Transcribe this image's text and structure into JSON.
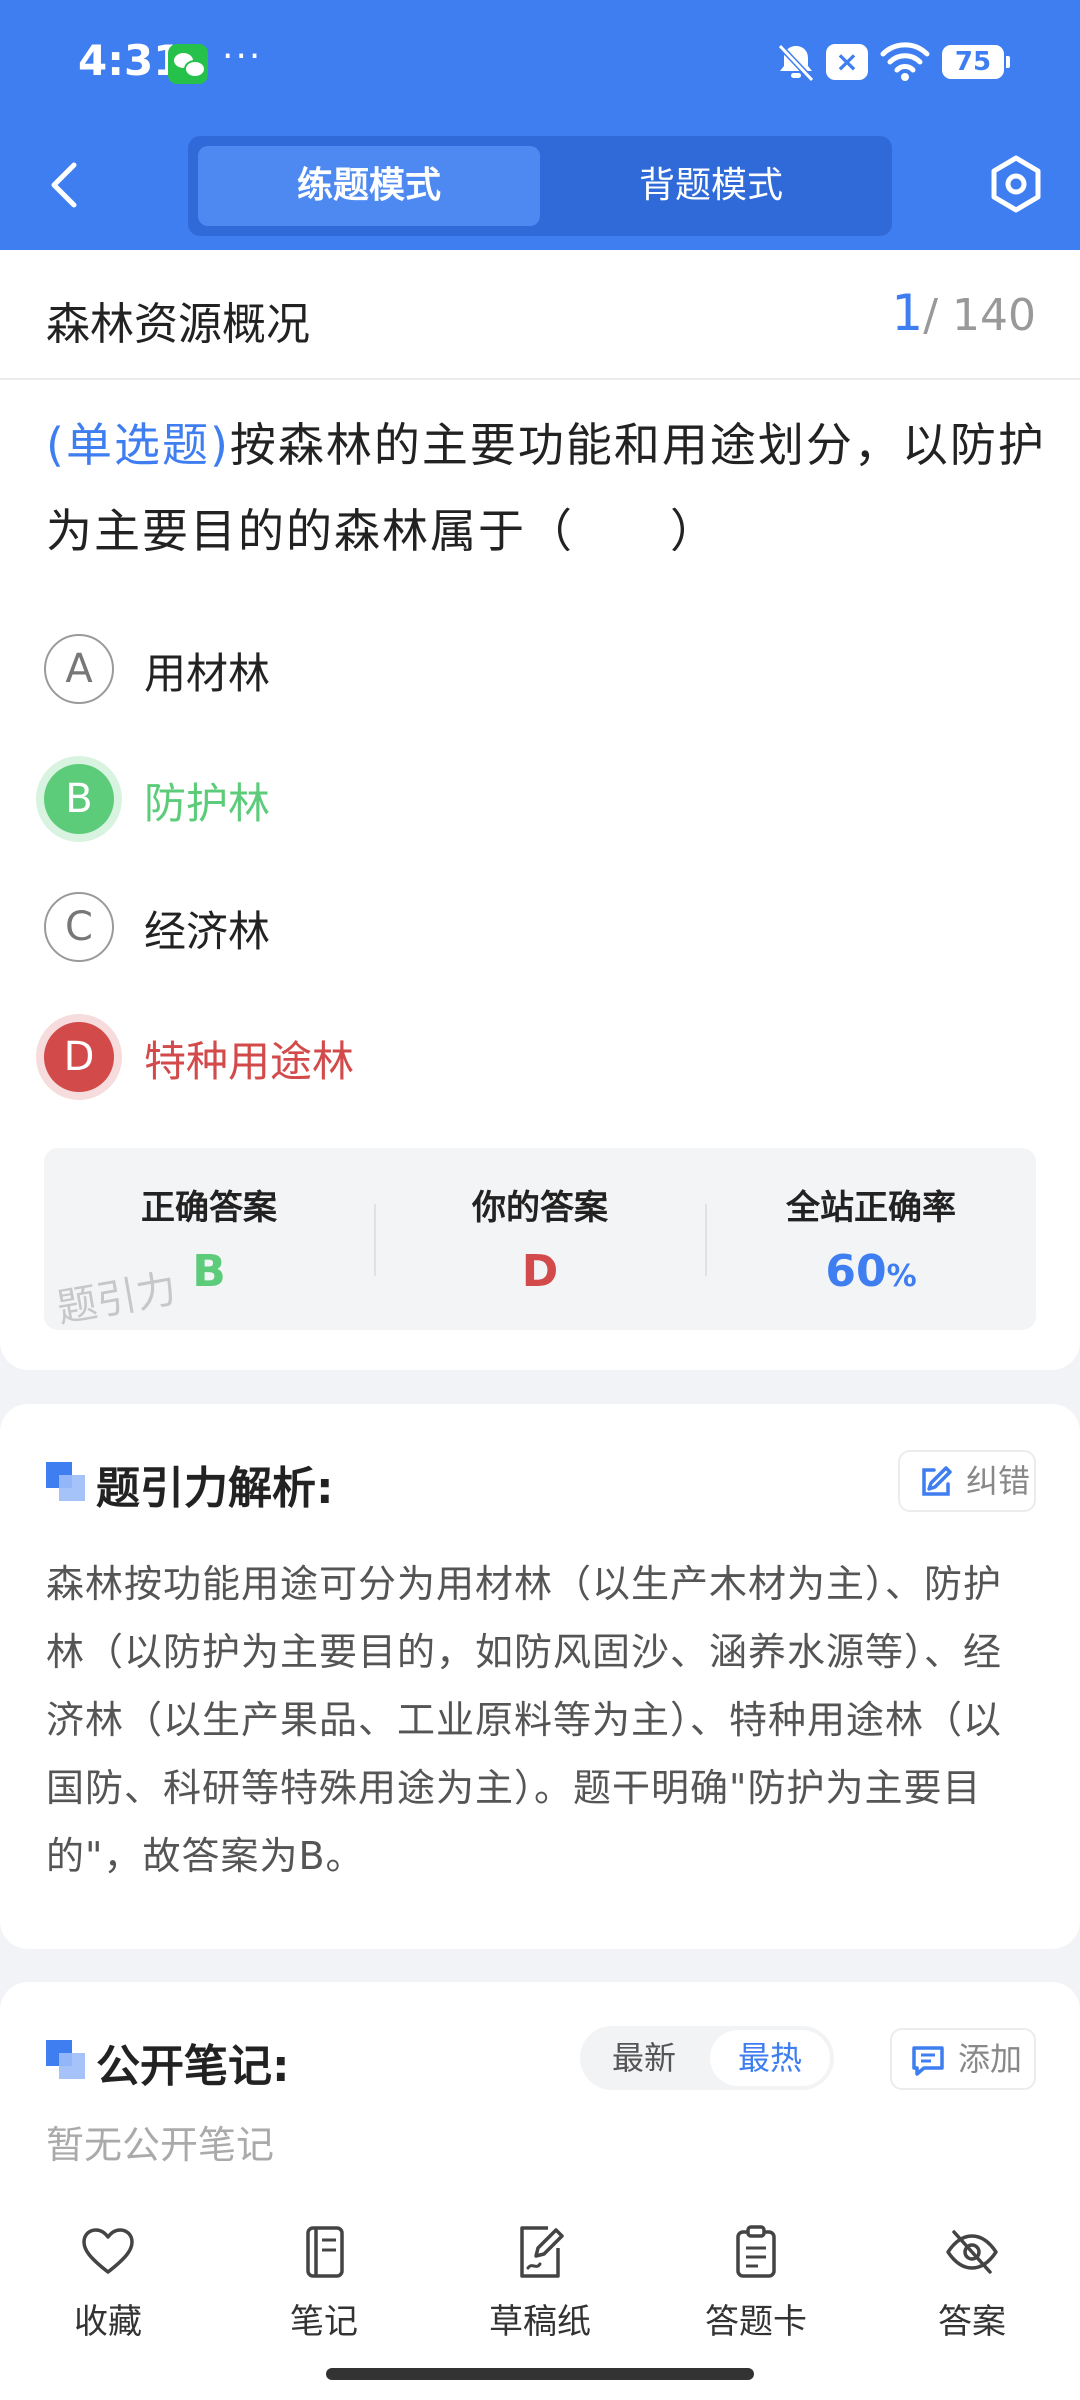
{
  "status_bar": {
    "time": "4:31",
    "more": "···",
    "notif_badge": "×",
    "battery": "75"
  },
  "nav": {
    "tabs": [
      {
        "label": "练题模式",
        "active": true
      },
      {
        "label": "背题模式",
        "active": false
      }
    ]
  },
  "question": {
    "chapter": "森林资源概况",
    "current": "1",
    "total": "/ 140",
    "type": "(单选题)",
    "text": "按森林的主要功能和用途划分，以防护为主要目的的森林属于（　　）",
    "options": [
      {
        "letter": "A",
        "text": "用材林",
        "state": "plain"
      },
      {
        "letter": "B",
        "text": "防护林",
        "state": "correct"
      },
      {
        "letter": "C",
        "text": "经济林",
        "state": "plain"
      },
      {
        "letter": "D",
        "text": "特种用途林",
        "state": "wrong"
      }
    ]
  },
  "answers": {
    "correct_label": "正确答案",
    "correct_value": "B",
    "yours_label": "你的答案",
    "yours_value": "D",
    "rate_label": "全站正确率",
    "rate_value": "60",
    "rate_unit": "%",
    "watermark": "题引力"
  },
  "analysis": {
    "title": "题引力解析:",
    "report_label": "纠错",
    "text": "森林按功能用途可分为用材林（以生产木材为主）、防护林（以防护为主要目的，如防风固沙、涵养水源等）、经济林（以生产果品、工业原料等为主）、特种用途林（以国防、科研等特殊用途为主）。题干明确\"防护为主要目的\"，故答案为B。"
  },
  "notes": {
    "title": "公开笔记:",
    "sort_latest": "最新",
    "sort_hot": "最热",
    "add_label": "添加",
    "empty": "暂无公开笔记"
  },
  "bottom_tabs": [
    {
      "label": "收藏",
      "icon": "heart-icon"
    },
    {
      "label": "笔记",
      "icon": "notebook-icon"
    },
    {
      "label": "草稿纸",
      "icon": "draft-paper-icon"
    },
    {
      "label": "答题卡",
      "icon": "answer-card-icon"
    },
    {
      "label": "答案",
      "icon": "eye-off-icon"
    }
  ],
  "colors": {
    "primary": "#3f7ef0",
    "correct": "#5ccc7a",
    "wrong": "#d24a4a"
  }
}
